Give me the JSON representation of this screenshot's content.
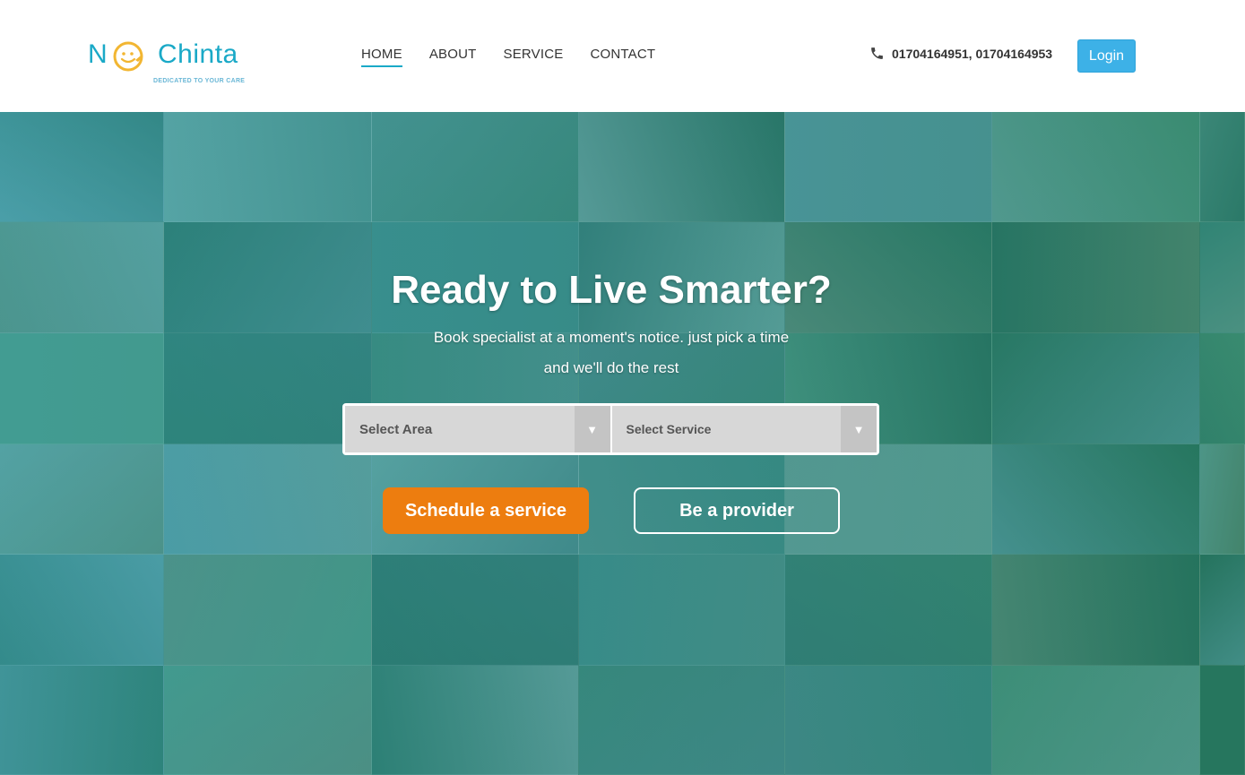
{
  "header": {
    "logo": {
      "brand_n": "N",
      "brand_rest": "Chinta",
      "tagline": "DEDICATED TO YOUR CARE"
    },
    "nav": [
      {
        "label": "HOME",
        "active": true
      },
      {
        "label": "ABOUT",
        "active": false
      },
      {
        "label": "SERVICE",
        "active": false
      },
      {
        "label": "CONTACT",
        "active": false
      }
    ],
    "phone": {
      "icon": "phone-icon",
      "number1": "01704164951",
      "separator": ", ",
      "number2": "01704164953"
    },
    "login_label": "Login"
  },
  "hero": {
    "title": "Ready to Live Smarter?",
    "subtitle": "Book specialist at a moment's notice. just pick a time and we'll do the rest",
    "select_area": {
      "selected": "Select Area",
      "icon": "dropdown-arrow-icon"
    },
    "select_service": {
      "selected": "Select Service",
      "icon": "dropdown-arrow-icon"
    },
    "schedule_label": "Schedule a service",
    "provider_label": "Be a provider"
  },
  "colors": {
    "brand": "#1aa9c7",
    "login": "#3db1e7",
    "schedule": "#ed7d0f",
    "logo_face": "#f2b632"
  }
}
